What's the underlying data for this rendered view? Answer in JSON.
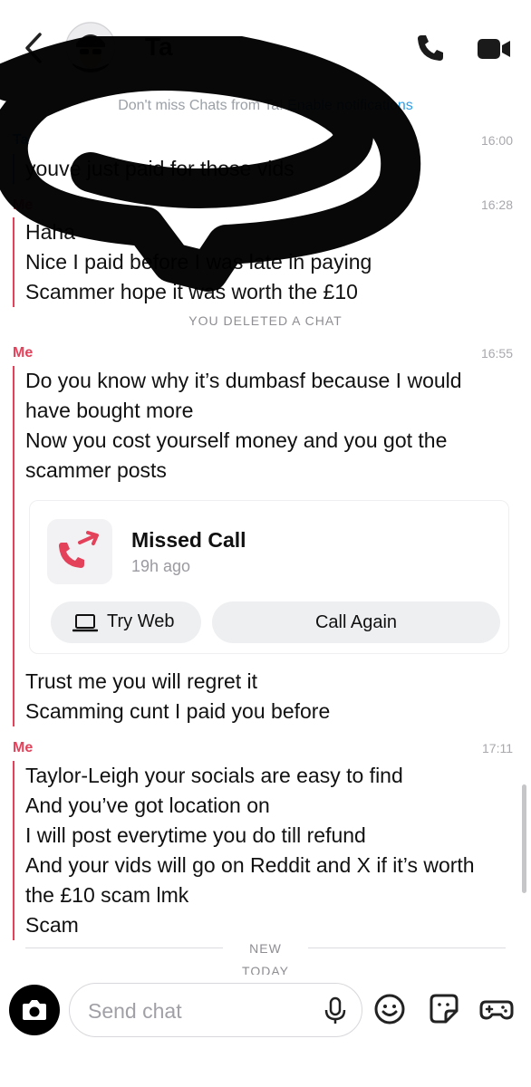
{
  "header": {
    "contact_name": "Ta",
    "back_icon": "chevron-left-icon",
    "call_icon": "phone-icon",
    "video_icon": "video-camera-icon"
  },
  "notification_bar": {
    "text": "Don't miss Chats from Ta!",
    "link": "Enable notifications"
  },
  "messages": [
    {
      "sender": "Ta",
      "time": "16:00",
      "lines": [
        "youve just paid for those vids"
      ]
    },
    {
      "sender": "Me",
      "time": "16:28",
      "lines": [
        "Haha",
        "Nice I paid before I was late in paying",
        "Scammer hope it was worth the £10"
      ]
    },
    {
      "system": "YOU DELETED A CHAT"
    },
    {
      "sender": "Me",
      "time": "16:55",
      "lines": [
        "Do you know why it’s dumbasf because I would",
        "have bought more",
        "Now you cost yourself money and you got the",
        "scammer posts"
      ],
      "lines_after_card": [
        "Trust me you will regret it",
        "Scamming cunt I paid you before"
      ]
    },
    {
      "sender": "Me",
      "time": "17:11",
      "lines": [
        "Taylor-Leigh your socials are easy to find",
        "And you’ve got location on",
        "I will post everytime you do till refund",
        "And your vids will go on Reddit and X if it’s worth",
        "the £10 scam lmk",
        "Scam"
      ]
    }
  ],
  "call_card": {
    "title": "Missed Call",
    "subtitle": "19h ago",
    "try_web_label": "Try Web",
    "call_again_label": "Call Again",
    "accent_color": "#e3425a"
  },
  "dividers": {
    "new_label": "NEW",
    "today_label": "TODAY"
  },
  "composer": {
    "placeholder": "Send chat",
    "value": "",
    "icons": [
      "camera-icon",
      "microphone-icon",
      "emoji-icon",
      "sticker-icon",
      "game-controller-icon"
    ]
  },
  "colors": {
    "them": "#2f9ee8",
    "me": "#e3425a",
    "muted": "#a8a8ad"
  }
}
